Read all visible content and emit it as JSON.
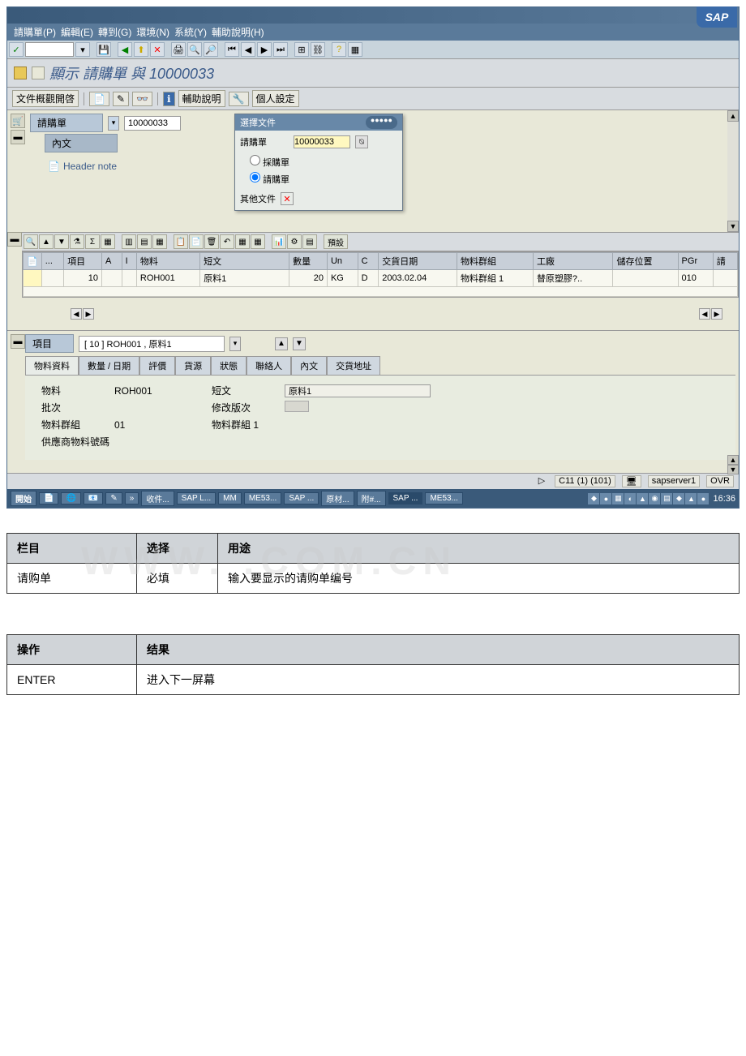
{
  "sap_logo": "SAP",
  "menubar": {
    "items": [
      "請購單(P)",
      "編輯(E)",
      "轉到(G)",
      "環境(N)",
      "系統(Y)",
      "輔助說明(H)"
    ]
  },
  "page_title": "顯示 請購單 與 10000033",
  "app_toolbar": {
    "doc_overview": "文件概觀開啓",
    "help_btn": "輔助說明",
    "personal_btn": "個人設定"
  },
  "header": {
    "label_pr": "請購單",
    "pr_value": "10000033",
    "label_content": "內文",
    "header_note": "Header note"
  },
  "popup": {
    "title": "選擇文件",
    "label_pr": "請購單",
    "value": "10000033",
    "radio1": "採購單",
    "radio2": "請購單",
    "other_doc": "其他文件"
  },
  "grid": {
    "headers": [
      "",
      "...",
      "項目",
      "A",
      "I",
      "物料",
      "短文",
      "數量",
      "Un",
      "C",
      "交貨日期",
      "物料群組",
      "工廠",
      "儲存位置",
      "PGr",
      "請"
    ],
    "row": {
      "item": "10",
      "material": "ROH001",
      "short_text": "原料1",
      "qty": "20",
      "unit": "KG",
      "c": "D",
      "deliv_date": "2003.02.04",
      "mat_group": "物料群組 1",
      "plant": "替原塑膠?..",
      "pgr": "010"
    }
  },
  "item_section": {
    "label": "項目",
    "combo_value": "[ 10 ] ROH001 , 原料1",
    "tabs": [
      "物料資料",
      "數量 / 日期",
      "評價",
      "貨源",
      "狀態",
      "聯絡人",
      "內文",
      "交貨地址"
    ],
    "fields": {
      "material_label": "物料",
      "material_value": "ROH001",
      "short_text_label": "短文",
      "short_text_value": "原料1",
      "batch_label": "批次",
      "revision_label": "修改版次",
      "mat_group_label": "物料群組",
      "mat_group_code": "01",
      "mat_group_desc": "物料群組 1",
      "vendor_mat_label": "供應商物料號碼"
    }
  },
  "statusbar": {
    "system": "C11 (1) (101)",
    "server": "sapserver1",
    "mode": "OVR"
  },
  "taskbar": {
    "start": "開始",
    "items": [
      "收件...",
      "SAP L...",
      "MM",
      "ME53...",
      "SAP ...",
      "原材...",
      "附#...",
      "SAP ...",
      "ME53..."
    ],
    "time": "16:36"
  },
  "table1": {
    "h1": "栏目",
    "h2": "选择",
    "h3": "用途",
    "r1c1": "请购单",
    "r1c2": "必填",
    "r1c3": "输入要显示的请购单编号"
  },
  "table2": {
    "h1": "操作",
    "h2": "结果",
    "r1c1": "ENTER",
    "r1c2": "进入下一屏幕"
  },
  "watermark": "WWW. .COM.CN"
}
